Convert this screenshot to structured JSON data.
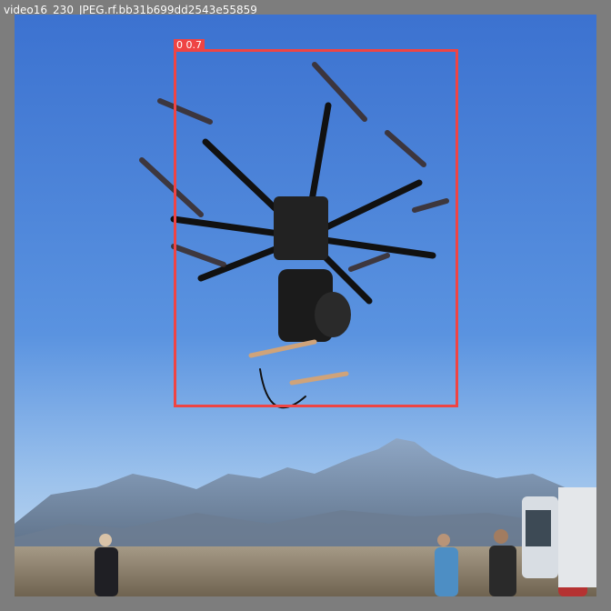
{
  "header": {
    "title": "video16_230_JPEG.rf.bb31b699dd2543e55859"
  },
  "detection": {
    "label": "0 0.7",
    "class_id": "0",
    "confidence": "0.7"
  },
  "colors": {
    "background": "#7d7d7d",
    "box": "#ef4444",
    "sky_top": "#3f78d6",
    "sky_bottom": "#b7d4ef",
    "ground": "#8a7a64"
  },
  "scene": {
    "subject": "drone-icon",
    "elements": [
      "mountain-range",
      "desert-ground",
      "person",
      "vehicle"
    ]
  }
}
